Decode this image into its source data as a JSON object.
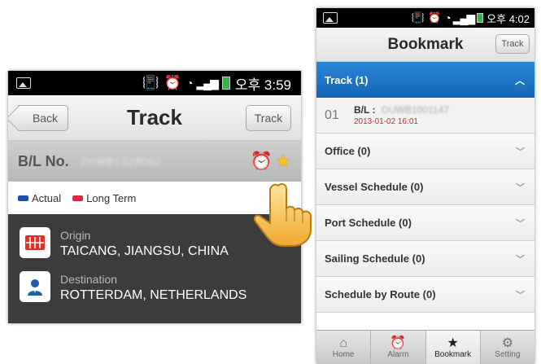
{
  "left": {
    "status": {
      "time": "오후 3:59"
    },
    "header": {
      "back_label": "Back",
      "title": "Track",
      "track_label": "Track"
    },
    "bl": {
      "label": "B/L No.",
      "number": "ZHWB1328060"
    },
    "legend": [
      {
        "label": "Actual",
        "color": "#1f4fa6"
      },
      {
        "label": "Long Term",
        "color": "#e0283b"
      }
    ],
    "route": {
      "origin_label": "Origin",
      "origin_value": "TAICANG, JIANGSU, CHINA",
      "destination_label": "Destination",
      "destination_value": "ROTTERDAM, NETHERLANDS"
    }
  },
  "right": {
    "status": {
      "time": "오후 4:02"
    },
    "header": {
      "title": "Bookmark",
      "track_label": "Track"
    },
    "track_section": {
      "label": "Track (1)"
    },
    "bookmark": {
      "index": "01",
      "bl_label": "B/L :",
      "bl_number": "OUWB1001147",
      "date": "2013-01-02 16:01"
    },
    "sections": [
      "Office (0)",
      "Vessel Schedule (0)",
      "Port Schedule (0)",
      "Sailing Schedule (0)",
      "Schedule by Route (0)"
    ],
    "tabs": [
      {
        "label": "Home",
        "icon": "home-icon"
      },
      {
        "label": "Alarm",
        "icon": "alarm-icon"
      },
      {
        "label": "Bookmark",
        "icon": "star-icon",
        "active": true
      },
      {
        "label": "Setting",
        "icon": "gear-icon"
      }
    ]
  }
}
